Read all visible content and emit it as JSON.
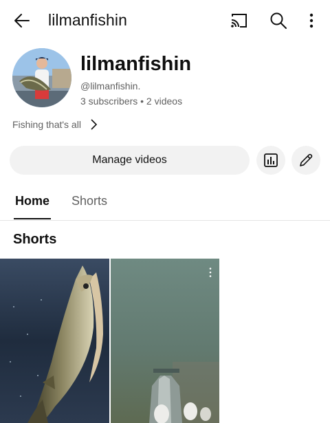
{
  "header": {
    "title": "lilmanfishin"
  },
  "channel": {
    "name": "lilmanfishin",
    "handle": "@lilmanfishin.",
    "stats": "3 subscribers • 2 videos",
    "description": "Fishing that's all"
  },
  "actions": {
    "manage_label": "Manage videos"
  },
  "tabs": [
    {
      "label": "Home",
      "selected": true
    },
    {
      "label": "Shorts",
      "selected": false
    }
  ],
  "section": {
    "title": "Shorts"
  },
  "icons": {
    "back": "arrow-left-icon",
    "cast": "cast-icon",
    "search": "search-icon",
    "more": "more-vertical-icon",
    "analytics": "analytics-icon",
    "edit": "pencil-icon"
  }
}
